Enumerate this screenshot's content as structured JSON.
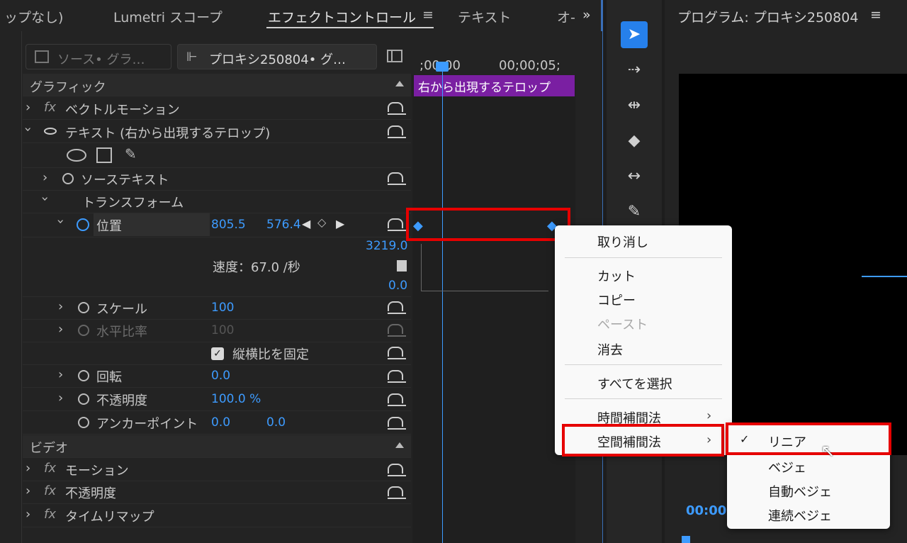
{
  "tabs": {
    "t0": "ップなし)",
    "t1": "Lumetri スコープ",
    "t2": "エフェクトコントロール",
    "t3": "テキスト",
    "t4": "オ-",
    "menu_glyph": "≡",
    "more": "»"
  },
  "source": {
    "a": "ソース• グラ…",
    "b": "プロキシ250804• グ…"
  },
  "ruler": {
    "start": ";00;00",
    "end": "00;00;05;"
  },
  "clip": "右から出現するテロップ",
  "sections": {
    "graphic": "グラフィック",
    "video": "ビデオ"
  },
  "rows": {
    "vector": "ベクトルモーション",
    "text": "テキスト (右から出現するテロップ)",
    "source_text": "ソーステキスト",
    "transform": "トランスフォーム",
    "position": "位置",
    "pos_x": "805.5",
    "pos_y": "576.4",
    "speed_max": "3219.0",
    "speed": "速度：67.0 /秒",
    "speed_min": "0.0",
    "scale": "スケール",
    "scale_val": "100",
    "hscale": "水平比率",
    "hscale_val": "100",
    "lock": "縦横比を固定",
    "rotate": "回転",
    "rotate_val": "0.0",
    "opacity": "不透明度",
    "opacity_val": "100.0 %",
    "anchor": "アンカーポイント",
    "anchor_x": "0.0",
    "anchor_y": "0.0",
    "motion": "モーション",
    "opacity2": "不透明度",
    "remap": "タイムリマップ"
  },
  "context_menu": {
    "undo": "取り消し",
    "cut": "カット",
    "copy": "コピー",
    "paste": "ペースト",
    "clear": "消去",
    "select_all": "すべてを選択",
    "temporal": "時間補間法",
    "spatial": "空間補間法"
  },
  "submenu": {
    "linear": "リニア",
    "bezier": "ベジェ",
    "auto_bezier": "自動ベジェ",
    "continuous_bezier": "連続ベジェ",
    "check": "✓"
  },
  "program": {
    "title": "プログラム: プロキシ250804",
    "menu_glyph": "≡",
    "timecode": "00:00"
  },
  "colors": {
    "accent": "#3d9bff",
    "clip": "#7a1fa2",
    "highlight": "#e60000"
  }
}
